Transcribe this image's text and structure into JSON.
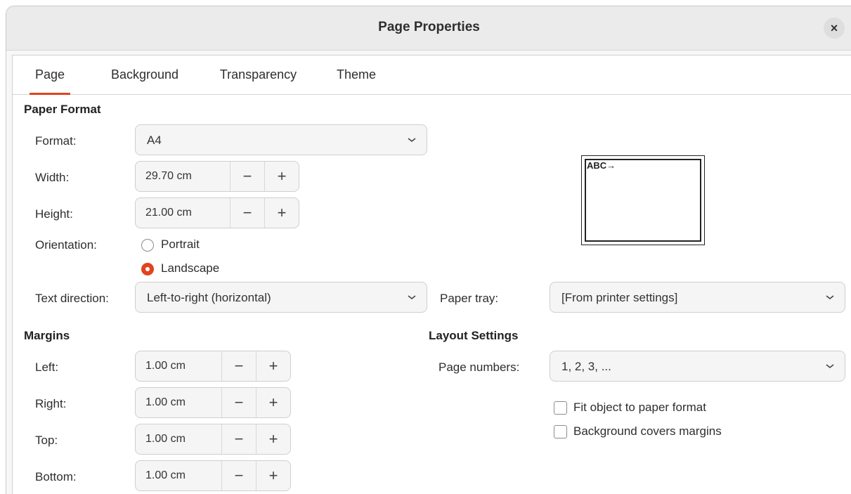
{
  "dialog": {
    "title": "Page Properties",
    "close_icon": "close-icon"
  },
  "tabs": [
    {
      "label": "Page",
      "active": true
    },
    {
      "label": "Background",
      "active": false
    },
    {
      "label": "Transparency",
      "active": false
    },
    {
      "label": "Theme",
      "active": false
    }
  ],
  "paper_format": {
    "heading": "Paper Format",
    "format_label": "Format:",
    "format_value": "A4",
    "width_label": "Width:",
    "width_value": "29.70 cm",
    "height_label": "Height:",
    "height_value": "21.00 cm",
    "orientation_label": "Orientation:",
    "portrait_label": "Portrait",
    "landscape_label": "Landscape",
    "orientation_selected": "Landscape",
    "text_direction_label": "Text direction:",
    "text_direction_value": "Left-to-right (horizontal)",
    "paper_tray_label": "Paper tray:",
    "paper_tray_value": "[From printer settings]",
    "preview_text": "ABC→"
  },
  "margins": {
    "heading": "Margins",
    "left_label": "Left:",
    "left_value": "1.00 cm",
    "right_label": "Right:",
    "right_value": "1.00 cm",
    "top_label": "Top:",
    "top_value": "1.00 cm",
    "bottom_label": "Bottom:",
    "bottom_value": "1.00 cm"
  },
  "layout": {
    "heading": "Layout Settings",
    "page_numbers_label": "Page numbers:",
    "page_numbers_value": "1, 2, 3, ...",
    "fit_object_label": "Fit object to paper format",
    "fit_object_checked": false,
    "bg_covers_label": "Background covers margins",
    "bg_covers_checked": false
  },
  "spin": {
    "minus": "−",
    "plus": "+"
  },
  "colors": {
    "accent": "#e0451f"
  }
}
